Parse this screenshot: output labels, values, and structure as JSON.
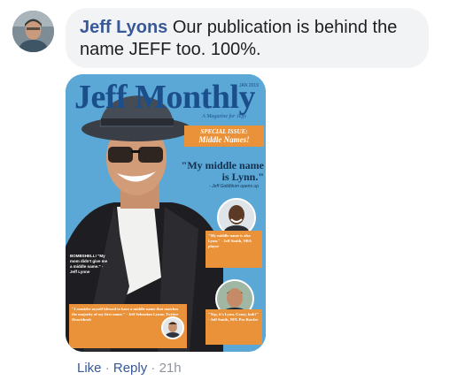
{
  "comment": {
    "author": "Jeff Lyons",
    "text": " Our publication is behind the name JEFF too. 100%."
  },
  "magazine": {
    "masthead": "Jeff Monthly",
    "issue": "JAN 2019",
    "tagline": "A Magazine for Jeffs",
    "special_line1": "SPECIAL ISSUE:",
    "special_line2": "Middle Names!",
    "main_quote": "\"My middle name is Lynn.\"",
    "main_quote_credit": "- Jeff Goldblum opens up",
    "side_quote_top": "\"My middle name is also Lynn.\" - Jeff Smith, NBA player",
    "side_quote_bottom": "\"Yep, it's Lynn. Crazy, huh?\" - Jeff Smith, NFL Pro Bowler",
    "left_note": "BOMBSHELL! \"My mom didn't give me a middle name.\" - Jeff Lynne",
    "bottom_quote": "\"I consider myself blessed to have a middle name that matches the majority of my first name.\" - Jeff Sebastian Lynne, Twitter Heartthrob"
  },
  "actions": {
    "like": "Like",
    "separator": "·",
    "reply": "Reply",
    "time": "21h"
  },
  "colors": {
    "link": "#385898",
    "bubble": "#f2f3f5",
    "cover_bg": "#5ba8d6",
    "accent_orange": "#e9923a",
    "masthead": "#1b4f8c"
  }
}
